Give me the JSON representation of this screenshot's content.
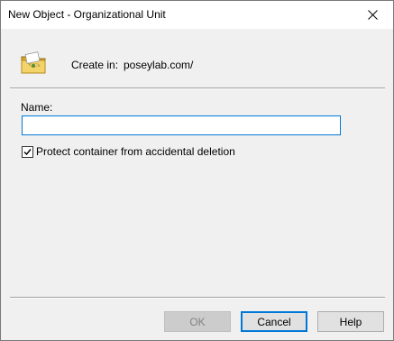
{
  "window": {
    "title": "New Object - Organizational Unit"
  },
  "titlebar": {
    "close_icon": "close-icon"
  },
  "header": {
    "icon": "organizational-unit-icon",
    "create_in_label": "Create in:",
    "create_in_path": "poseylab.com/"
  },
  "form": {
    "name_label": "Name:",
    "name_value": "",
    "protect_checkbox_checked": true,
    "protect_label": "Protect container from accidental deletion"
  },
  "buttons": {
    "ok_label": "OK",
    "ok_enabled": false,
    "cancel_label": "Cancel",
    "help_label": "Help"
  },
  "colors": {
    "focus_accent": "#0078d7",
    "dialog_background": "#f0f0f0"
  }
}
